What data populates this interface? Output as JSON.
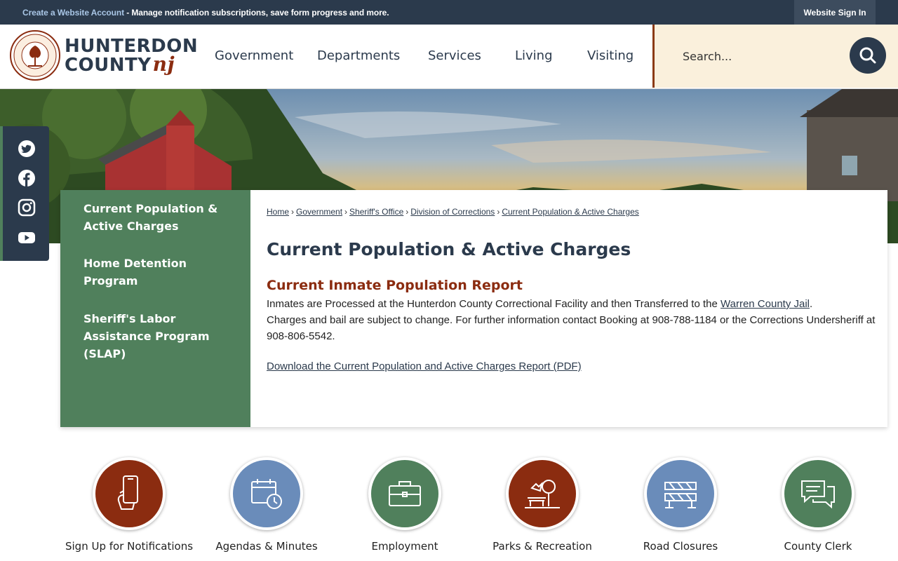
{
  "topbar": {
    "account_link": "Create a Website Account",
    "account_desc": " - Manage notification subscriptions, save form progress and more.",
    "signin": "Website Sign In"
  },
  "header": {
    "logo_line1": "HUNTERDON",
    "logo_line2": "COUNTY",
    "logo_nj": "nj",
    "seal_text_top": "HUNTERDON COUNTY",
    "seal_text_bottom": "NEW JERSEY",
    "nav": [
      "Government",
      "Departments",
      "Services",
      "Living",
      "Visiting"
    ],
    "search_placeholder": "Search..."
  },
  "social": [
    "twitter-icon",
    "facebook-icon",
    "instagram-icon",
    "youtube-icon"
  ],
  "sidebar": {
    "items": [
      "Current Population & Active Charges",
      "Home Detention Program",
      "Sheriff's Labor Assistance Program (SLAP)"
    ]
  },
  "breadcrumb": [
    "Home",
    "Government",
    "Sheriff's Office",
    "Division of Corrections",
    "Current Population & Active Charges"
  ],
  "main": {
    "title": "Current Population & Active Charges",
    "section_title": "Current Inmate Population Report",
    "para_line1_pre": "Inmates are Processed at the Hunterdon County Correctional Facility and then Transferred to the ",
    "para_link": "Warren County Jail",
    "para_line1_post": ".",
    "para_line2": "Charges and bail are subject to change. For further information contact Booking at 908-788-1184 or the Corrections Undersheriff at 908-806-5542.",
    "pdf_link": "Download the Current Population and Active Charges Report (PDF)"
  },
  "quick_links": [
    {
      "label": "Sign Up for Notifications",
      "icon": "phone-icon",
      "color": "#8b2c10"
    },
    {
      "label": "Agendas & Minutes",
      "icon": "calendar-clock-icon",
      "color": "#6a8cba"
    },
    {
      "label": "Employment",
      "icon": "briefcase-icon",
      "color": "#50805c"
    },
    {
      "label": "Parks & Recreation",
      "icon": "park-icon",
      "color": "#8b2c10"
    },
    {
      "label": "Road Closures",
      "icon": "barricade-icon",
      "color": "#6a8cba"
    },
    {
      "label": "County Clerk",
      "icon": "chat-icon",
      "color": "#50805c"
    }
  ],
  "colors": {
    "navy": "#2b3a4c",
    "green": "#50805c",
    "rust": "#8b2c10",
    "blue": "#6a8cba",
    "cream": "#faf0dc"
  }
}
